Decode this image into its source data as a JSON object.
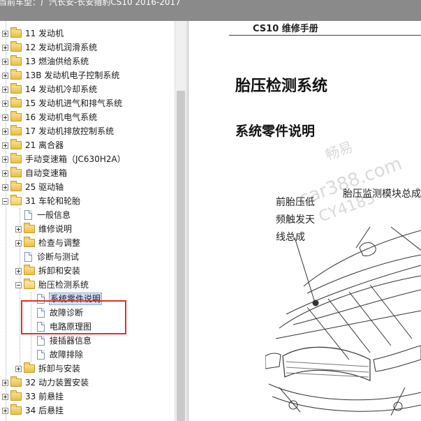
{
  "window": {
    "title": "当前车型：广汽长安-长安猎豹CS10 2016-2017"
  },
  "tree": {
    "items": [
      {
        "label": "11 发动机"
      },
      {
        "label": "12 发动机润滑系统"
      },
      {
        "label": "13 燃油供给系统"
      },
      {
        "label": "13B 发动机电子控制系统"
      },
      {
        "label": "14 发动机冷却系统"
      },
      {
        "label": "15 发动机进气和排气系统"
      },
      {
        "label": "16 发动机电气系统"
      },
      {
        "label": "17 发动机排放控制系统"
      },
      {
        "label": "21 离合器"
      },
      {
        "label": "手动变速箱（JC630H2A）"
      },
      {
        "label": "自动变速箱"
      },
      {
        "label": "25 驱动轴"
      },
      {
        "label": "31 车轮和轮胎"
      },
      {
        "label": "一般信息"
      },
      {
        "label": "维修说明"
      },
      {
        "label": "检查与调整"
      },
      {
        "label": "诊断与测试"
      },
      {
        "label": "拆卸和安装"
      },
      {
        "label": "胎压检测系统"
      },
      {
        "label": "系统零件说明"
      },
      {
        "label": "故障诊断"
      },
      {
        "label": "电路原理图"
      },
      {
        "label": "接插器信息"
      },
      {
        "label": "故障排除"
      },
      {
        "label": "拆卸与安装"
      },
      {
        "label": "32 动力装置安装"
      },
      {
        "label": "33 前悬挂"
      },
      {
        "label": "34 后悬挂"
      }
    ],
    "selected_label": "系统零件说明"
  },
  "document": {
    "header": "CS10 维修手册",
    "title": "胎压检测系统",
    "subtitle": "系统零件说明",
    "callout_left": "前胎压低频触发天线总成",
    "callout_right": "胎压监测模块总成",
    "watermark_1": "畅易",
    "watermark_2": "car388.com",
    "watermark_3": "CY4185"
  },
  "colors": {
    "titlebar_bg": "#8a8a8a",
    "highlight_box": "#e0302a",
    "selection_bg": "#cfe0f7"
  }
}
